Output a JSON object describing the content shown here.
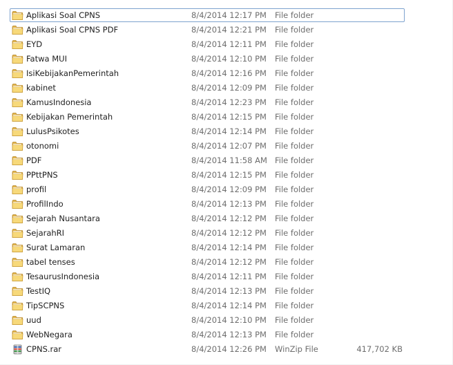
{
  "files": [
    {
      "name": "Aplikasi Soal CPNS",
      "date": "8/4/2014 12:17 PM",
      "type": "File folder",
      "size": "",
      "icon": "folder-icon"
    },
    {
      "name": "Aplikasi Soal CPNS PDF",
      "date": "8/4/2014 12:21 PM",
      "type": "File folder",
      "size": "",
      "icon": "folder-icon"
    },
    {
      "name": "EYD",
      "date": "8/4/2014 12:11 PM",
      "type": "File folder",
      "size": "",
      "icon": "folder-icon"
    },
    {
      "name": "Fatwa MUI",
      "date": "8/4/2014 12:10 PM",
      "type": "File folder",
      "size": "",
      "icon": "folder-icon"
    },
    {
      "name": "IsiKebijakanPemerintah",
      "date": "8/4/2014 12:16 PM",
      "type": "File folder",
      "size": "",
      "icon": "folder-icon"
    },
    {
      "name": "kabinet",
      "date": "8/4/2014 12:09 PM",
      "type": "File folder",
      "size": "",
      "icon": "folder-icon"
    },
    {
      "name": "KamusIndonesia",
      "date": "8/4/2014 12:23 PM",
      "type": "File folder",
      "size": "",
      "icon": "folder-icon"
    },
    {
      "name": "Kebijakan Pemerintah",
      "date": "8/4/2014 12:15 PM",
      "type": "File folder",
      "size": "",
      "icon": "folder-icon"
    },
    {
      "name": "LulusPsikotes",
      "date": "8/4/2014 12:14 PM",
      "type": "File folder",
      "size": "",
      "icon": "folder-icon"
    },
    {
      "name": "otonomi",
      "date": "8/4/2014 12:07 PM",
      "type": "File folder",
      "size": "",
      "icon": "folder-icon"
    },
    {
      "name": "PDF",
      "date": "8/4/2014 11:58 AM",
      "type": "File folder",
      "size": "",
      "icon": "folder-icon"
    },
    {
      "name": "PPttPNS",
      "date": "8/4/2014 12:15 PM",
      "type": "File folder",
      "size": "",
      "icon": "folder-icon"
    },
    {
      "name": "profil",
      "date": "8/4/2014 12:09 PM",
      "type": "File folder",
      "size": "",
      "icon": "folder-icon"
    },
    {
      "name": "ProfilIndo",
      "date": "8/4/2014 12:13 PM",
      "type": "File folder",
      "size": "",
      "icon": "folder-icon"
    },
    {
      "name": "Sejarah Nusantara",
      "date": "8/4/2014 12:12 PM",
      "type": "File folder",
      "size": "",
      "icon": "folder-icon"
    },
    {
      "name": "SejarahRI",
      "date": "8/4/2014 12:12 PM",
      "type": "File folder",
      "size": "",
      "icon": "folder-icon"
    },
    {
      "name": "Surat Lamaran",
      "date": "8/4/2014 12:14 PM",
      "type": "File folder",
      "size": "",
      "icon": "folder-icon"
    },
    {
      "name": "tabel tenses",
      "date": "8/4/2014 12:12 PM",
      "type": "File folder",
      "size": "",
      "icon": "folder-icon"
    },
    {
      "name": "TesaurusIndonesia",
      "date": "8/4/2014 12:11 PM",
      "type": "File folder",
      "size": "",
      "icon": "folder-icon"
    },
    {
      "name": "TestIQ",
      "date": "8/4/2014 12:13 PM",
      "type": "File folder",
      "size": "",
      "icon": "folder-icon"
    },
    {
      "name": "TipSCPNS",
      "date": "8/4/2014 12:14 PM",
      "type": "File folder",
      "size": "",
      "icon": "folder-icon"
    },
    {
      "name": "uud",
      "date": "8/4/2014 12:10 PM",
      "type": "File folder",
      "size": "",
      "icon": "folder-icon"
    },
    {
      "name": "WebNegara",
      "date": "8/4/2014 12:13 PM",
      "type": "File folder",
      "size": "",
      "icon": "folder-icon"
    },
    {
      "name": "CPNS.rar",
      "date": "8/4/2014 12:26 PM",
      "type": "WinZip File",
      "size": "417,702 KB",
      "icon": "winzip-archive-icon"
    }
  ],
  "colors": {
    "folder_back": "#e0b34a",
    "folder_front": "#f7d97a",
    "focus_border": "#7da2ce",
    "secondary_text": "#6d6d6d"
  }
}
